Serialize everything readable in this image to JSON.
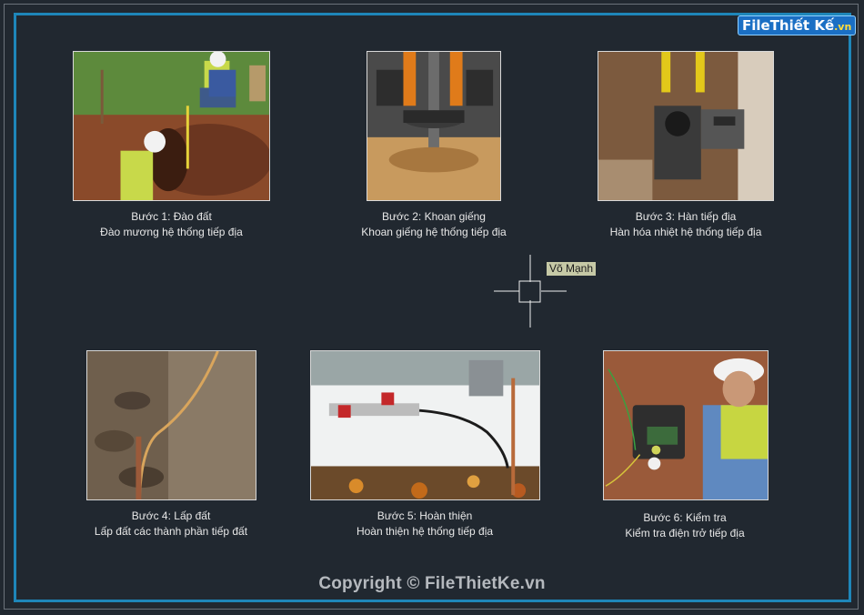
{
  "logo": {
    "text": "FileThiếtKế.vn",
    "part1": "File",
    "part2": "Thiết Kế",
    "part3": ".vn"
  },
  "crosshair_label": "Võ Mạnh",
  "steps": [
    {
      "title": "Bước 1: Đào đất",
      "desc": "Đào mương hệ thống tiếp địa",
      "image": "digging-trench-photo"
    },
    {
      "title": "Bước 2: Khoan giếng",
      "desc": "Khoan giếng hệ thống tiếp địa",
      "image": "drilling-well-photo"
    },
    {
      "title": "Bước 3: Hàn tiếp địa",
      "desc": "Hàn hóa nhiệt hệ thống tiếp địa",
      "image": "exothermic-welding-photo"
    },
    {
      "title": "Bước 4: Lấp đất",
      "desc": "Lấp đất các thành phần tiếp đất",
      "image": "backfill-photo"
    },
    {
      "title": "Bước 5: Hoàn thiện",
      "desc": "Hoàn thiện hệ thống tiếp địa",
      "image": "finished-system-photo"
    },
    {
      "title": "Bước 6: Kiểm tra",
      "desc": "Kiểm tra điện trở tiếp địa",
      "image": "resistance-test-photo"
    }
  ],
  "copyright": "Copyright © FileThietKe.vn",
  "colors": {
    "background": "#212830",
    "frame": "#1e86b9",
    "caption": "#e8e8e8"
  }
}
